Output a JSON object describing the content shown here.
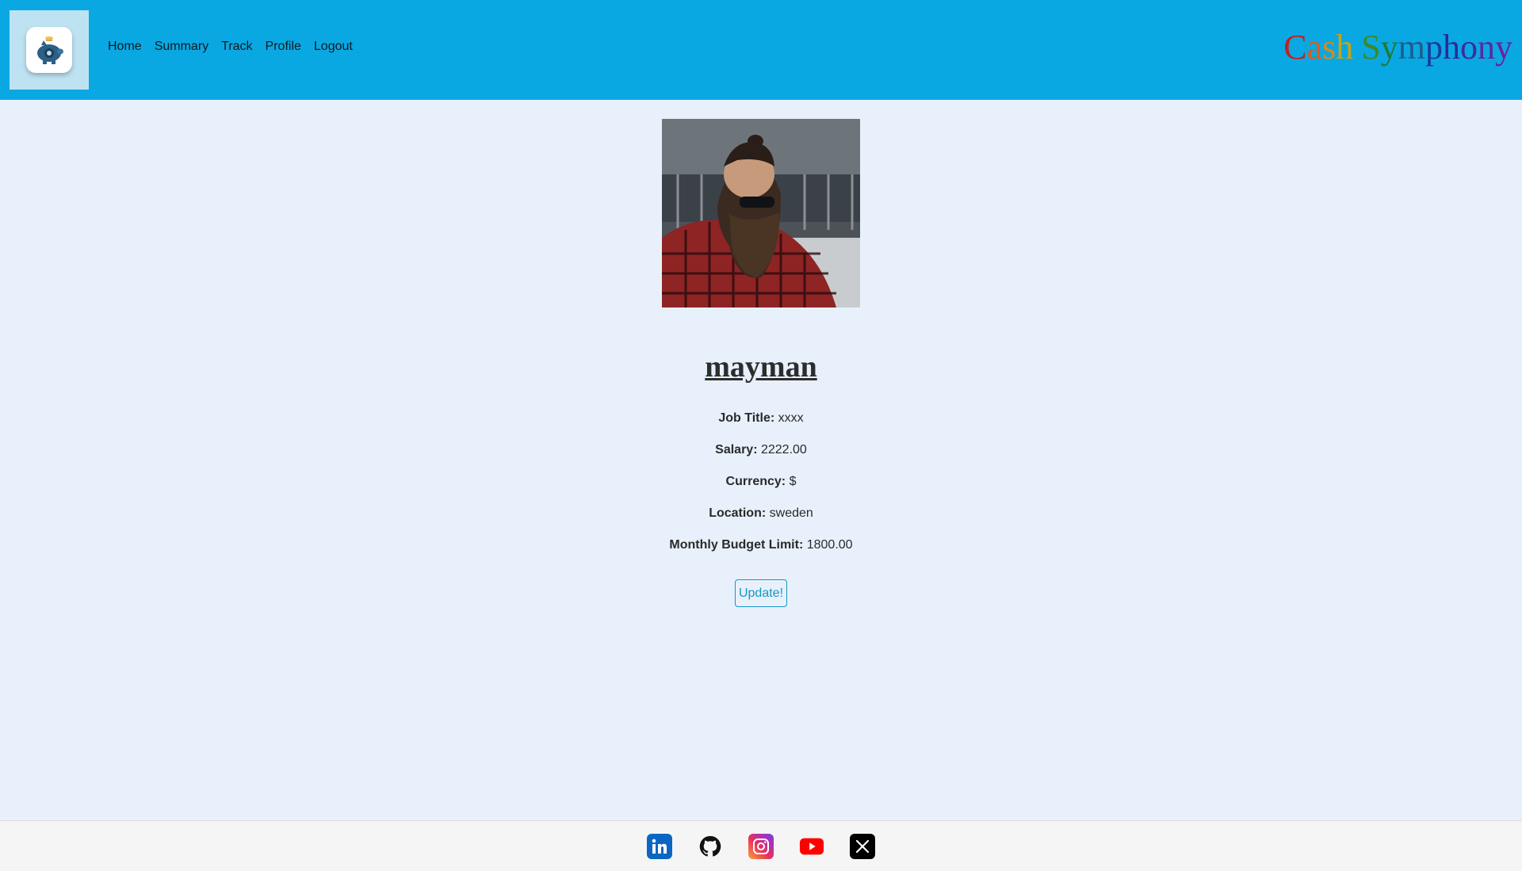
{
  "navbar": {
    "logo_icon": "piggy-bank-icon",
    "links": [
      {
        "label": "Home"
      },
      {
        "label": "Summary"
      },
      {
        "label": "Track"
      },
      {
        "label": "Profile"
      },
      {
        "label": "Logout"
      }
    ],
    "brand_letters": [
      "C",
      "a",
      "s",
      "h",
      " ",
      "S",
      "y",
      "m",
      "p",
      "h",
      "o",
      "n",
      "y"
    ],
    "brand_colors": [
      "#c41f1f",
      "#e05a1a",
      "#d98a16",
      "#c8a412",
      "#000000",
      "#3a8a2a",
      "#1f7a3a",
      "#1c5d8f",
      "#1c3a9a",
      "#2b2a9e",
      "#3c2aa0",
      "#5a2aa0",
      "#6a20a0"
    ],
    "bg_color": "#0aa8e2"
  },
  "profile": {
    "username": "mayman",
    "fields": [
      {
        "label": "Job Title:",
        "value": "xxxx"
      },
      {
        "label": "Salary:",
        "value": "2222.00"
      },
      {
        "label": "Currency:",
        "value": "$"
      },
      {
        "label": "Location:",
        "value": "sweden"
      },
      {
        "label": "Monthly Budget Limit:",
        "value": "1800.00"
      }
    ],
    "update_label": "Update!"
  },
  "footer": {
    "icons": [
      "linkedin-icon",
      "github-icon",
      "instagram-icon",
      "youtube-icon",
      "x-icon"
    ]
  }
}
